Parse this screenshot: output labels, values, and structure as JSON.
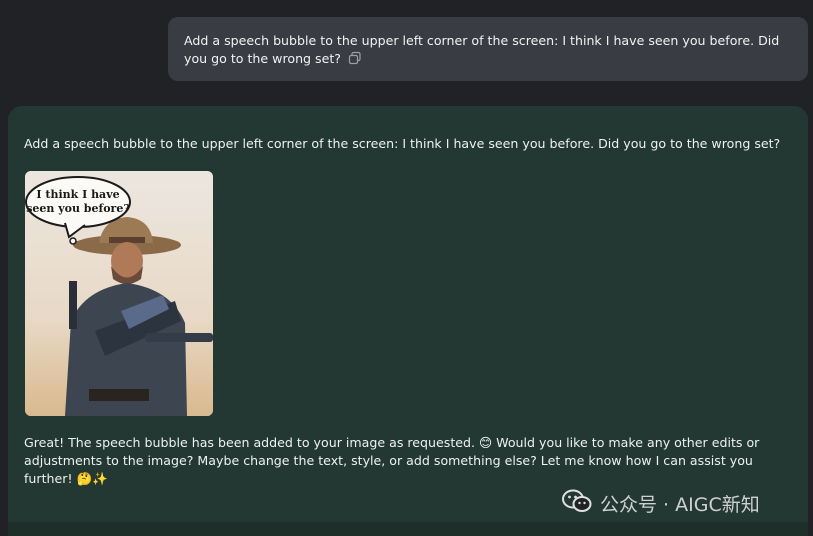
{
  "user_message": {
    "text": "Add a speech bubble to the upper left corner of the screen: I think I have seen you before. Did you go to the wrong set?",
    "copy_icon": "copy-icon"
  },
  "assistant": {
    "echo_text": "Add a speech bubble to the upper left corner of the screen: I think I have seen you before. Did you go to the wrong set?",
    "image": {
      "bubble_line1": "I think I have",
      "bubble_line2": "seen you before?"
    },
    "reply_text": "Great! The speech bubble has been added to your image as requested. 😊 Would you like to make any other edits or adjustments to the image? Maybe change the text, style, or add something else? Let me know how I can assist you further! 🤔✨"
  },
  "watermark": {
    "icon": "wechat-icon",
    "text": "公众号 · AIGC新知"
  },
  "colors": {
    "page_bg": "#212226",
    "user_bubble_bg": "#3a3c43",
    "assistant_bg": "#233832"
  }
}
